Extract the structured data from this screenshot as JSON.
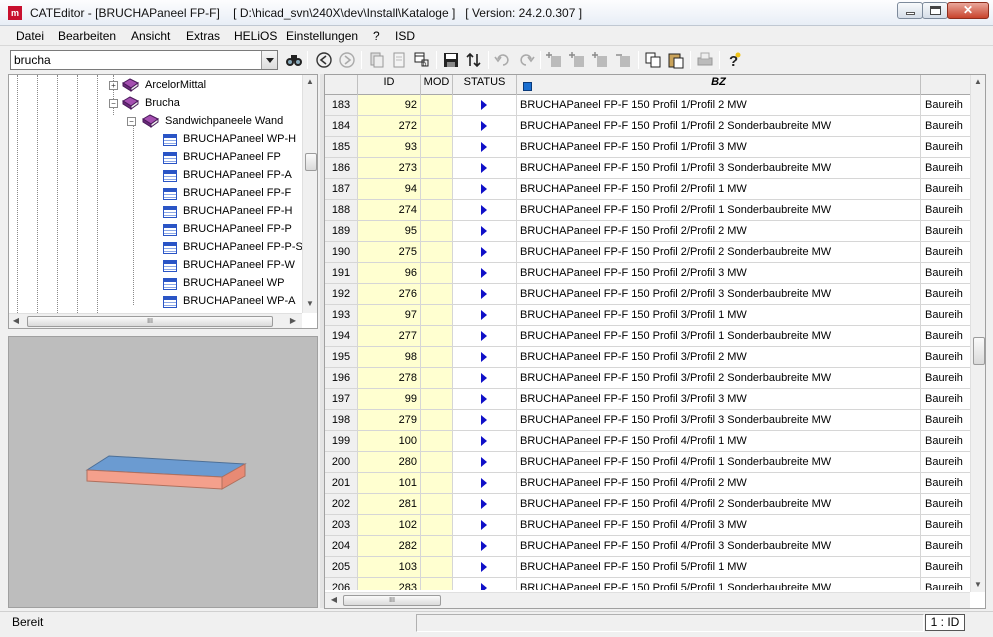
{
  "window": {
    "title": "CATEditor - [BRUCHAPaneel FP-F]    [ D:\\hicad_svn\\240X\\dev\\Install\\Kataloge ]   [ Version: 24.2.0.307 ]",
    "app_icon": "m"
  },
  "menu": [
    "Datei",
    "Bearbeiten",
    "Ansicht",
    "Extras",
    "HELiOS",
    "Einstellungen",
    "?",
    "ISD"
  ],
  "toolbar": {
    "search_value": "brucha",
    "binoculars_icon": "binoculars-icon"
  },
  "tree": {
    "nodes": [
      {
        "label": "ArcelorMittal",
        "icon": "book-icon",
        "toggle": "+"
      },
      {
        "label": "Brucha",
        "icon": "book-icon",
        "toggle": "−"
      },
      {
        "label": "Sandwichpaneele Wand",
        "icon": "book-icon",
        "toggle": "−"
      },
      {
        "label": "BRUCHAPaneel WP-H",
        "icon": "table-icon"
      },
      {
        "label": "BRUCHAPaneel FP",
        "icon": "table-icon"
      },
      {
        "label": "BRUCHAPaneel FP-A",
        "icon": "table-icon"
      },
      {
        "label": "BRUCHAPaneel FP-F",
        "icon": "table-icon"
      },
      {
        "label": "BRUCHAPaneel FP-H",
        "icon": "table-icon"
      },
      {
        "label": "BRUCHAPaneel FP-P",
        "icon": "table-icon"
      },
      {
        "label": "BRUCHAPaneel FP-P-S",
        "icon": "table-icon"
      },
      {
        "label": "BRUCHAPaneel FP-W",
        "icon": "table-icon"
      },
      {
        "label": "BRUCHAPaneel WP",
        "icon": "table-icon"
      },
      {
        "label": "BRUCHAPaneel WP-A",
        "icon": "table-icon"
      }
    ],
    "hscroll_grip": "III"
  },
  "grid": {
    "headers": {
      "id": "ID",
      "mod": "MOD",
      "status": "STATUS",
      "bz": "BZ"
    },
    "hscroll_grip": "III",
    "rows": [
      {
        "rn": "183",
        "id": "92",
        "bz": "BRUCHAPaneel FP-F 150 Profil 1/Profil 2 MW",
        "extra": "Baureih"
      },
      {
        "rn": "184",
        "id": "272",
        "bz": "BRUCHAPaneel FP-F 150 Profil 1/Profil 2 Sonderbaubreite MW",
        "extra": "Baureih"
      },
      {
        "rn": "185",
        "id": "93",
        "bz": "BRUCHAPaneel FP-F 150 Profil 1/Profil 3 MW",
        "extra": "Baureih"
      },
      {
        "rn": "186",
        "id": "273",
        "bz": "BRUCHAPaneel FP-F 150 Profil 1/Profil 3 Sonderbaubreite MW",
        "extra": "Baureih"
      },
      {
        "rn": "187",
        "id": "94",
        "bz": "BRUCHAPaneel FP-F 150 Profil 2/Profil 1 MW",
        "extra": "Baureih"
      },
      {
        "rn": "188",
        "id": "274",
        "bz": "BRUCHAPaneel FP-F 150 Profil 2/Profil 1 Sonderbaubreite MW",
        "extra": "Baureih"
      },
      {
        "rn": "189",
        "id": "95",
        "bz": "BRUCHAPaneel FP-F 150 Profil 2/Profil 2 MW",
        "extra": "Baureih"
      },
      {
        "rn": "190",
        "id": "275",
        "bz": "BRUCHAPaneel FP-F 150 Profil 2/Profil 2 Sonderbaubreite MW",
        "extra": "Baureih"
      },
      {
        "rn": "191",
        "id": "96",
        "bz": "BRUCHAPaneel FP-F 150 Profil 2/Profil 3 MW",
        "extra": "Baureih"
      },
      {
        "rn": "192",
        "id": "276",
        "bz": "BRUCHAPaneel FP-F 150 Profil 2/Profil 3 Sonderbaubreite MW",
        "extra": "Baureih"
      },
      {
        "rn": "193",
        "id": "97",
        "bz": "BRUCHAPaneel FP-F 150 Profil 3/Profil 1 MW",
        "extra": "Baureih"
      },
      {
        "rn": "194",
        "id": "277",
        "bz": "BRUCHAPaneel FP-F 150 Profil 3/Profil 1 Sonderbaubreite MW",
        "extra": "Baureih"
      },
      {
        "rn": "195",
        "id": "98",
        "bz": "BRUCHAPaneel FP-F 150 Profil 3/Profil 2 MW",
        "extra": "Baureih"
      },
      {
        "rn": "196",
        "id": "278",
        "bz": "BRUCHAPaneel FP-F 150 Profil 3/Profil 2 Sonderbaubreite MW",
        "extra": "Baureih"
      },
      {
        "rn": "197",
        "id": "99",
        "bz": "BRUCHAPaneel FP-F 150 Profil 3/Profil 3 MW",
        "extra": "Baureih"
      },
      {
        "rn": "198",
        "id": "279",
        "bz": "BRUCHAPaneel FP-F 150 Profil 3/Profil 3 Sonderbaubreite MW",
        "extra": "Baureih"
      },
      {
        "rn": "199",
        "id": "100",
        "bz": "BRUCHAPaneel FP-F 150 Profil 4/Profil 1 MW",
        "extra": "Baureih"
      },
      {
        "rn": "200",
        "id": "280",
        "bz": "BRUCHAPaneel FP-F 150 Profil 4/Profil 1 Sonderbaubreite MW",
        "extra": "Baureih"
      },
      {
        "rn": "201",
        "id": "101",
        "bz": "BRUCHAPaneel FP-F 150 Profil 4/Profil 2 MW",
        "extra": "Baureih"
      },
      {
        "rn": "202",
        "id": "281",
        "bz": "BRUCHAPaneel FP-F 150 Profil 4/Profil 2 Sonderbaubreite MW",
        "extra": "Baureih"
      },
      {
        "rn": "203",
        "id": "102",
        "bz": "BRUCHAPaneel FP-F 150 Profil 4/Profil 3 MW",
        "extra": "Baureih"
      },
      {
        "rn": "204",
        "id": "282",
        "bz": "BRUCHAPaneel FP-F 150 Profil 4/Profil 3 Sonderbaubreite MW",
        "extra": "Baureih"
      },
      {
        "rn": "205",
        "id": "103",
        "bz": "BRUCHAPaneel FP-F 150 Profil 5/Profil 1 MW",
        "extra": "Baureih"
      },
      {
        "rn": "206",
        "id": "283",
        "bz": "BRUCHAPaneel FP-F 150 Profil 5/Profil 1 Sonderbaubreite MW",
        "extra": "Baureih"
      }
    ]
  },
  "preview": {
    "panel_top_color": "#6b9bd1",
    "panel_side_color": "#f4a08c",
    "background": "#bdbdbd"
  },
  "status": {
    "text": "Bereit",
    "indicator": "1 : ID"
  },
  "colors": {
    "id_column": "#ffffd0",
    "status_arrow": "#1010c8"
  }
}
